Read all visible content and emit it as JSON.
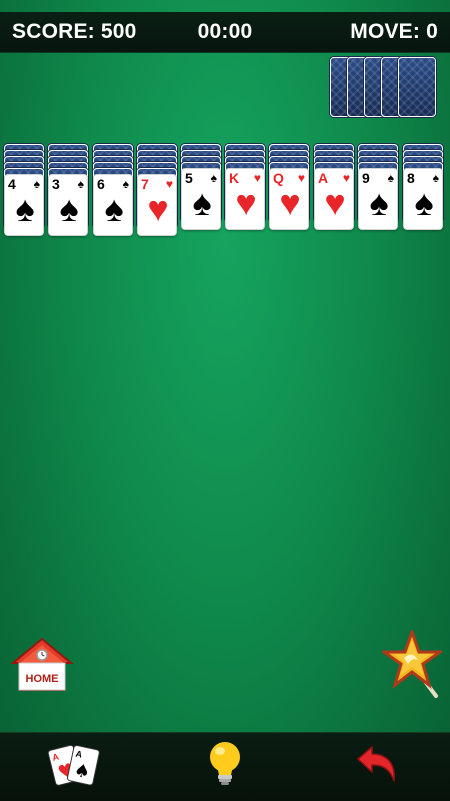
{
  "hud": {
    "score": "SCORE: 500",
    "time": "00:00",
    "moves": "MOVE: 0"
  },
  "stock": {
    "face_down_piles": 5
  },
  "tableau": [
    {
      "hidden": 5,
      "rank": "4",
      "suit": "♠",
      "color": "black"
    },
    {
      "hidden": 5,
      "rank": "3",
      "suit": "♠",
      "color": "black"
    },
    {
      "hidden": 5,
      "rank": "6",
      "suit": "♠",
      "color": "black"
    },
    {
      "hidden": 5,
      "rank": "7",
      "suit": "♥",
      "color": "red"
    },
    {
      "hidden": 4,
      "rank": "5",
      "suit": "♠",
      "color": "black"
    },
    {
      "hidden": 4,
      "rank": "K",
      "suit": "♥",
      "color": "red"
    },
    {
      "hidden": 4,
      "rank": "Q",
      "suit": "♥",
      "color": "red"
    },
    {
      "hidden": 4,
      "rank": "A",
      "suit": "♥",
      "color": "red"
    },
    {
      "hidden": 4,
      "rank": "9",
      "suit": "♠",
      "color": "black"
    },
    {
      "hidden": 4,
      "rank": "8",
      "suit": "♠",
      "color": "black"
    }
  ],
  "buttons": {
    "home_label": "HOME",
    "home_icon": "house-icon",
    "magic_icon": "magic-wand-star-icon",
    "new_game_icon": "playing-cards-icon",
    "hint_icon": "lightbulb-icon",
    "undo_icon": "undo-arrow-icon"
  },
  "colors": {
    "felt": "#0f8a4c",
    "card_back": "#1f3a6d",
    "red_suit": "#e8262a",
    "bar": "#07150e"
  }
}
